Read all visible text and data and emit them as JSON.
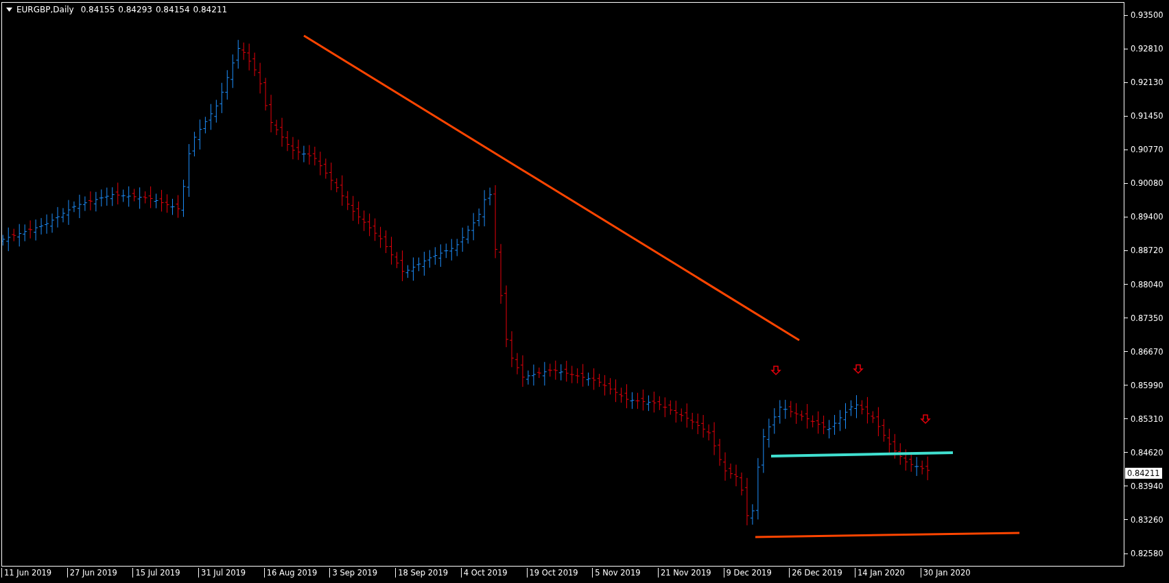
{
  "chart": {
    "symbol": "EURGBP,Daily",
    "ohlc": [
      "0.84155",
      "0.84293",
      "0.84154",
      "0.84211"
    ],
    "current_price": "0.84211",
    "price_axis": [
      "0.93500",
      "0.92810",
      "0.92130",
      "0.91450",
      "0.90770",
      "0.90080",
      "0.89400",
      "0.88720",
      "0.88040",
      "0.87350",
      "0.86670",
      "0.85990",
      "0.85310",
      "0.84620",
      "0.83940",
      "0.83260",
      "0.82580"
    ],
    "time_axis": [
      "11 Jun 2019",
      "27 Jun 2019",
      "15 Jul 2019",
      "31 Jul 2019",
      "16 Aug 2019",
      "3 Sep 2019",
      "18 Sep 2019",
      "4 Oct 2019",
      "19 Oct 2019",
      "5 Nov 2019",
      "21 Nov 2019",
      "9 Dec 2019",
      "26 Dec 2019",
      "14 Jan 2020",
      "30 Jan 2020"
    ]
  }
}
